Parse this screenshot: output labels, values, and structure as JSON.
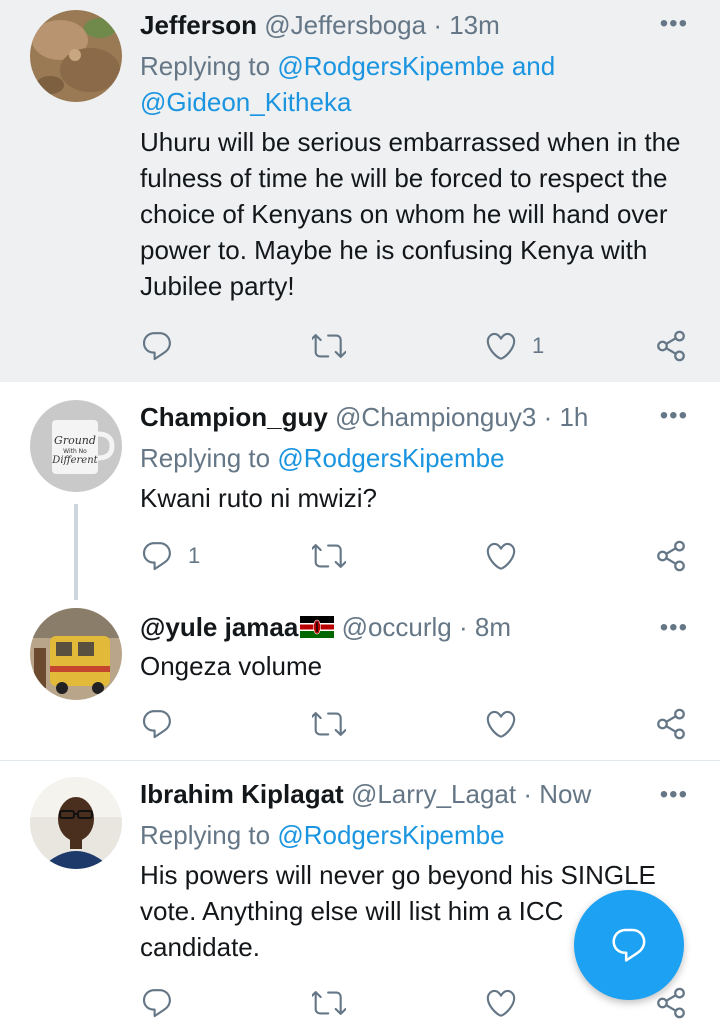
{
  "tweets": [
    {
      "name": "Jefferson",
      "handle": "@Jeffersboga",
      "sep": "·",
      "time": "13m",
      "replying_prefix": "Replying to",
      "replying_mentions_1": "@RodgersKipembe and",
      "replying_mentions_2": "@Gideon_Kitheka",
      "text": "Uhuru will be serious embarrassed when in the fulness of time he will be forced to respect the choice of Kenyans on whom he will hand over power to. Maybe he is confusing Kenya with Jubilee party!",
      "reply_count": "",
      "retweet_count": "",
      "like_count": "1"
    },
    {
      "name": "Champion_guy",
      "handle": "@Championguy3",
      "sep": "·",
      "time": "1h",
      "replying_prefix": "Replying to",
      "replying_mentions_1": "@RodgersKipembe",
      "text": "Kwani ruto ni mwizi?",
      "reply_count": "1",
      "retweet_count": "",
      "like_count": "",
      "avatar_text": [
        "Ground",
        "With No",
        "Different"
      ]
    },
    {
      "name": "@yule jamaa",
      "handle": "@occurlg",
      "sep": "·",
      "time": "8m",
      "text": "Ongeza volume",
      "reply_count": "",
      "retweet_count": "",
      "like_count": ""
    },
    {
      "name": "Ibrahim Kiplagat",
      "handle": "@Larry_Lagat",
      "sep": "·",
      "time": "Now",
      "replying_prefix": "Replying to",
      "replying_mentions_1": "@RodgersKipembe",
      "text": "His powers will never go beyond his SINGLE vote. Anything else will list him a ICC candidate.",
      "reply_count": "",
      "retweet_count": "",
      "like_count": ""
    }
  ],
  "more_label": "•••",
  "colors": {
    "accent": "#1da1f2",
    "mention": "#1b95e0",
    "secondary_text": "#657786",
    "highlight_bg": "#eef0f2"
  },
  "icons": [
    "reply-icon",
    "retweet-icon",
    "like-icon",
    "share-icon",
    "more-icon",
    "compose-reply-icon",
    "kenya-flag-icon"
  ]
}
